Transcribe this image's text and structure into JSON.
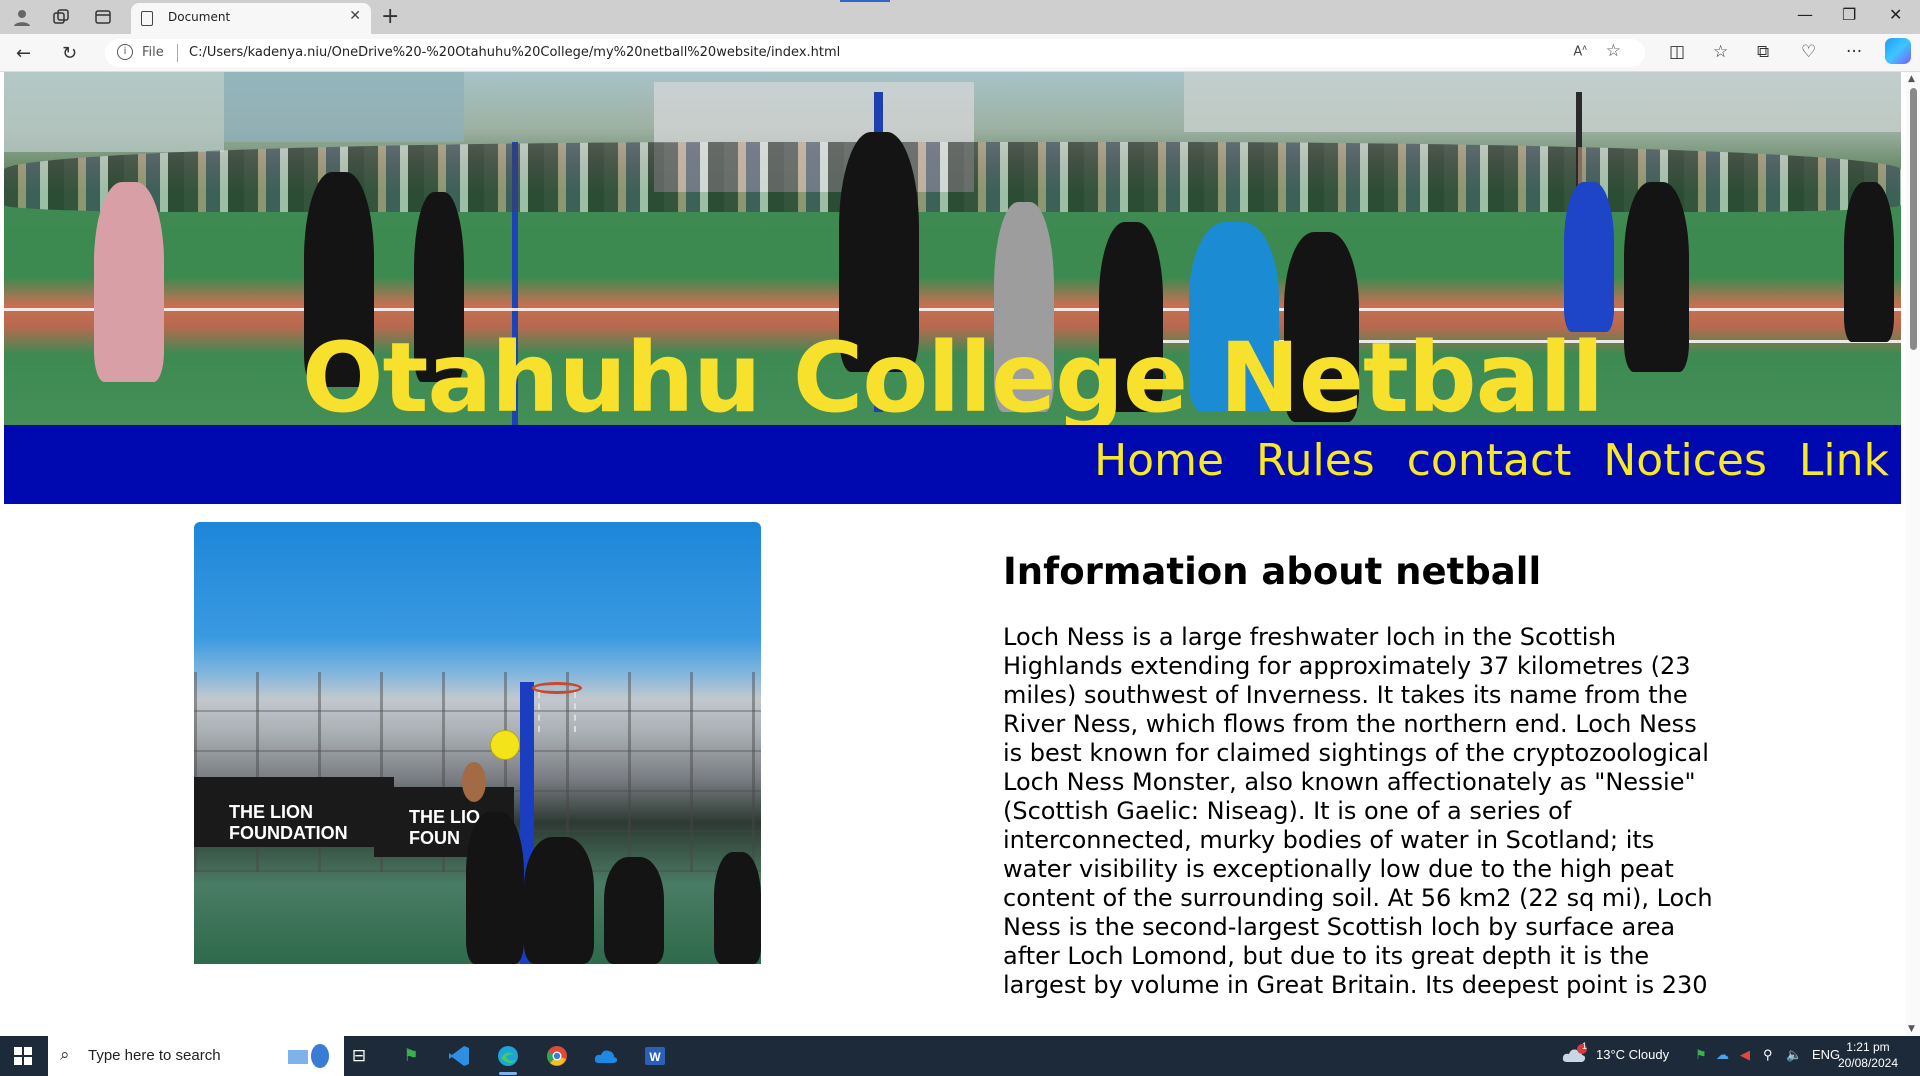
{
  "browser": {
    "tab_title": "Document",
    "address_prefix": "File",
    "url": "C:/Users/kadenya.niu/OneDrive%20-%20Otahuhu%20College/my%20netball%20website/index.html"
  },
  "site": {
    "title": "Otahuhu College Netball",
    "nav": [
      "Home",
      "Rules",
      "contact",
      "Notices",
      "Link"
    ],
    "info_heading": "Information about netball",
    "info_text": "Loch Ness is a large freshwater loch in the Scottish Highlands extending for approximately 37 kilometres (23 miles) southwest of Inverness. It takes its name from the River Ness, which flows from the northern end. Loch Ness is best known for claimed sightings of the cryptozoological Loch Ness Monster, also known affectionately as \"Nessie\" (Scottish Gaelic: Niseag). It is one of a series of interconnected, murky bodies of water in Scotland; its water visibility is exceptionally low due to the high peat content of the surrounding soil. At 56 km2 (22 sq mi), Loch Ness is the second-largest Scottish loch by surface area after Loch Lomond, but due to its great depth it is the largest by volume in Great Britain. Its deepest point is 230",
    "photo_banner_text": "THE LION FOUNDATION",
    "photo_banner_text_short": "THE LIO FOUN",
    "title_color": "#f8e12c",
    "nav_bg": "#0008b0",
    "nav_link_color": "#f9e825"
  },
  "taskbar": {
    "search_placeholder": "Type here to search",
    "weather": "13°C  Cloudy",
    "language": "ENG",
    "time": "1:21 pm",
    "date": "20/08/2024",
    "weather_badge": "1"
  }
}
